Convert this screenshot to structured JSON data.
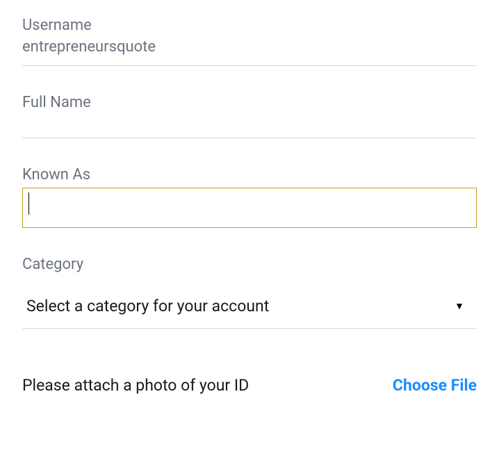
{
  "fields": {
    "username": {
      "label": "Username",
      "value": "entrepreneursquote"
    },
    "fullname": {
      "label": "Full Name",
      "value": ""
    },
    "knownas": {
      "label": "Known As",
      "value": ""
    },
    "category": {
      "label": "Category",
      "placeholder": "Select a category for your account"
    }
  },
  "attach": {
    "prompt": "Please attach a photo of your ID",
    "button": "Choose File"
  }
}
